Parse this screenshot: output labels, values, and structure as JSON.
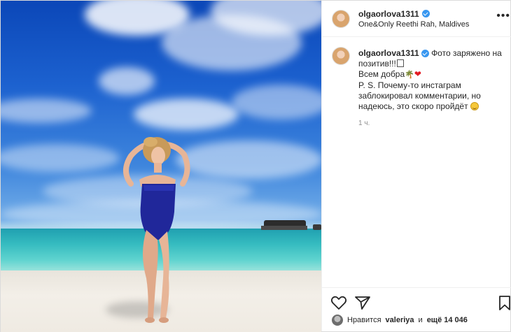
{
  "post": {
    "username": "olgaorlova1311",
    "location": "One&Only Reethi Rah, Maldives",
    "caption": {
      "line1": "Фото заряжено на",
      "line2": "позитив!!!",
      "line3": "Всем добра",
      "line4": "P. S. Почему-то инстаграм",
      "line5": "заблокировал комментарии, но",
      "line6": "надеюсь, это скоро пройдёт"
    },
    "time": "1 ч.",
    "likes": {
      "prefix": "Нравится",
      "user": "valeriya",
      "middle": "и",
      "count": "ещё 14 046"
    }
  },
  "icons": {
    "more": "more-options-icon",
    "verified": "verified-badge-icon",
    "like": "heart-outline-icon",
    "share": "paper-plane-icon",
    "save": "bookmark-icon"
  },
  "colors": {
    "verified": "#3897f0",
    "heart": "#e31b23",
    "muted": "#8e8e8e"
  }
}
